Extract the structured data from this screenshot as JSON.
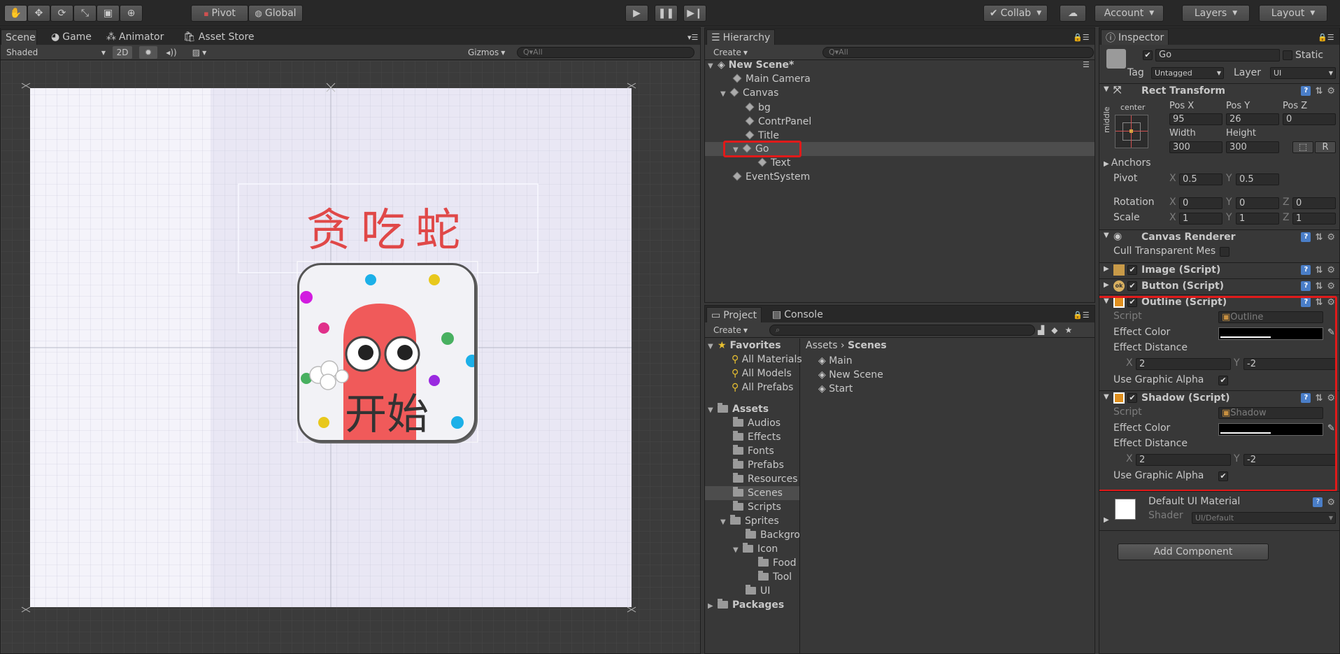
{
  "toolbar": {
    "pivot_label": "Pivot",
    "global_label": "Global",
    "collab_label": "Collab",
    "account_label": "Account",
    "layers_label": "Layers",
    "layout_label": "Layout"
  },
  "scene_panel": {
    "tabs": [
      "Scene",
      "Game",
      "Animator",
      "Asset Store"
    ],
    "shading_mode": "Shaded",
    "mode_2d": "2D",
    "gizmos_label": "Gizmos",
    "search_placeholder": "Q▾All",
    "title_text": "贪吃蛇",
    "button_text": "开始",
    "title_color": "#e04848",
    "dot_colors": [
      "#d21ce0",
      "#1cb0e8",
      "#e8c81c",
      "#e0308a",
      "#48b060",
      "#1cb0e8",
      "#e8c81c",
      "#9a2ae0"
    ]
  },
  "hierarchy": {
    "tab": "Hierarchy",
    "create_label": "Create",
    "search_placeholder": "Q▾All",
    "scene_name": "New Scene*",
    "items": [
      "Main Camera",
      "Canvas",
      "bg",
      "ContrPanel",
      "Title",
      "Go",
      "Text",
      "EventSystem"
    ]
  },
  "project": {
    "tabs": [
      "Project",
      "Console"
    ],
    "create_label": "Create",
    "favorites_label": "Favorites",
    "favorites": [
      "All Materials",
      "All Models",
      "All Prefabs"
    ],
    "assets_label": "Assets",
    "asset_folders": [
      "Audios",
      "Effects",
      "Fonts",
      "Prefabs",
      "Resources",
      "Scenes",
      "Scripts",
      "Sprites",
      "Backgrou",
      "Icon",
      "Food",
      "Tool",
      "UI"
    ],
    "packages_label": "Packages",
    "breadcrumb": [
      "Assets",
      "Scenes"
    ],
    "files": [
      "Main",
      "New Scene",
      "Start"
    ]
  },
  "inspector": {
    "tab": "Inspector",
    "object_name": "Go",
    "static_label": "Static",
    "tag_label": "Tag",
    "tag_value": "Untagged",
    "layer_label": "Layer",
    "layer_value": "UI",
    "rect_transform": {
      "title": "Rect Transform",
      "anchor_h": "center",
      "anchor_v": "middle",
      "pos_x_label": "Pos X",
      "pos_y_label": "Pos Y",
      "pos_z_label": "Pos Z",
      "pos_x": "95",
      "pos_y": "26",
      "pos_z": "0",
      "width_label": "Width",
      "height_label": "Height",
      "width": "300",
      "height": "300",
      "anchors_label": "Anchors",
      "pivot_label": "Pivot",
      "pivot_x": "0.5",
      "pivot_y": "0.5",
      "rotation_label": "Rotation",
      "rot_x": "0",
      "rot_y": "0",
      "rot_z": "0",
      "scale_label": "Scale",
      "scale_x": "1",
      "scale_y": "1",
      "scale_z": "1",
      "r_label": "R"
    },
    "canvas_renderer": {
      "title": "Canvas Renderer",
      "cull_label": "Cull Transparent Mes"
    },
    "image_script": "Image (Script)",
    "button_script": "Button (Script)",
    "outline": {
      "title": "Outline (Script)",
      "script_label": "Script",
      "script_value": "Outline",
      "effect_color_label": "Effect Color",
      "effect_distance_label": "Effect Distance",
      "x_label": "X",
      "x": "2",
      "y_label": "Y",
      "y": "-2",
      "use_alpha_label": "Use Graphic Alpha"
    },
    "shadow": {
      "title": "Shadow (Script)",
      "script_label": "Script",
      "script_value": "Shadow",
      "effect_color_label": "Effect Color",
      "effect_distance_label": "Effect Distance",
      "x_label": "X",
      "x": "2",
      "y_label": "Y",
      "y": "-2",
      "use_alpha_label": "Use Graphic Alpha"
    },
    "material": {
      "name": "Default UI Material",
      "shader_label": "Shader",
      "shader_value": "UI/Default"
    },
    "add_component_label": "Add Component"
  },
  "colors": {
    "highlight_red": "#e01a1a",
    "selection": "#4d4d4d"
  }
}
